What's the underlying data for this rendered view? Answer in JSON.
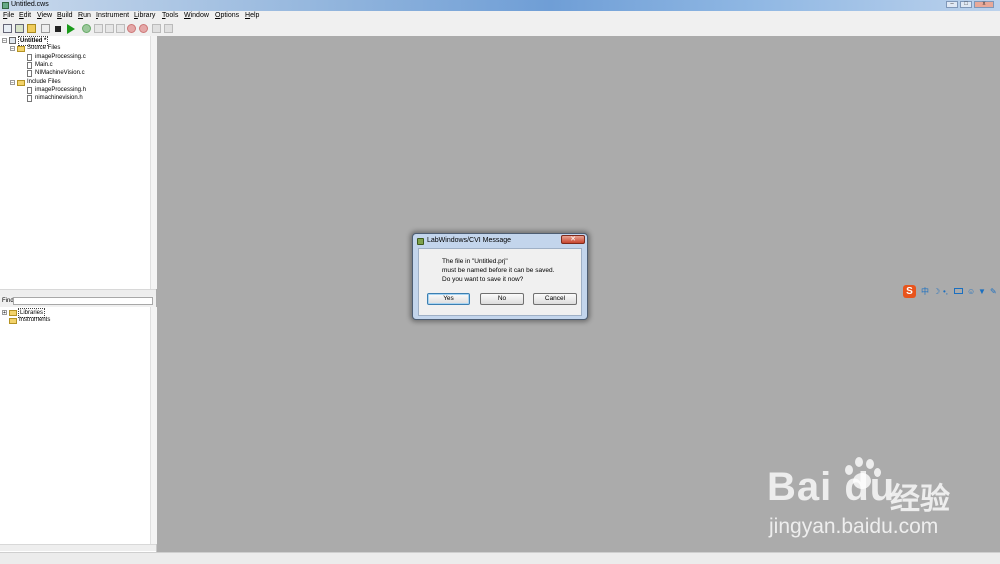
{
  "window": {
    "title": "Untitled.cws"
  },
  "menu": [
    {
      "key": "F",
      "rest": "ile"
    },
    {
      "key": "E",
      "rest": "dit"
    },
    {
      "key": "V",
      "rest": "iew"
    },
    {
      "key": "B",
      "rest": "uild"
    },
    {
      "key": "R",
      "rest": "un"
    },
    {
      "key": "I",
      "rest": "nstrument"
    },
    {
      "key": "L",
      "rest": "ibrary"
    },
    {
      "key": "T",
      "rest": "ools"
    },
    {
      "key": "W",
      "rest": "indow"
    },
    {
      "key": "O",
      "rest": "ptions"
    },
    {
      "key": "H",
      "rest": "elp"
    }
  ],
  "tree": {
    "project": "Untitled *",
    "source_folder": "Source Files",
    "source_files": [
      "imageProcessing.c",
      "Main.c",
      "NIMachineVision.c"
    ],
    "include_folder": "Include Files",
    "include_files": [
      "imageProcessing.h",
      "nimachinevision.h"
    ]
  },
  "find": {
    "label": "Find"
  },
  "library_tree": {
    "libraries": "Libraries",
    "instruments": "Instruments"
  },
  "dialog": {
    "title": "LabWindows/CVI Message",
    "close": "✕",
    "line1": "The file in \"Untitled.prj\"",
    "line2": "must be named before it can be saved.",
    "line3": "Do you want to save it now?",
    "yes": "Yes",
    "no": "No",
    "cancel": "Cancel"
  },
  "ime": {
    "logo": "S",
    "mode": "中"
  },
  "watermark": {
    "logo": "Bai du",
    "cn": "经验",
    "url": "jingyan.baidu.com"
  }
}
